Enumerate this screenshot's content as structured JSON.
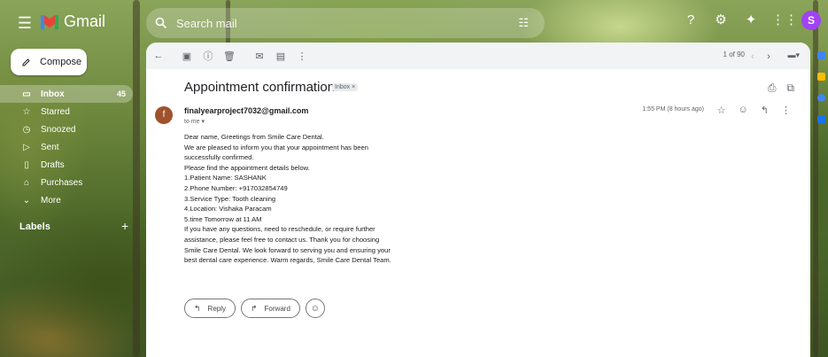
{
  "app": {
    "name": "Gmail"
  },
  "search": {
    "placeholder": "Search mail"
  },
  "compose": {
    "label": "Compose"
  },
  "sidebar": {
    "items": [
      {
        "label": "Inbox",
        "count": "45",
        "icon": "inbox-icon",
        "active": true
      },
      {
        "label": "Starred",
        "count": "",
        "icon": "star-icon"
      },
      {
        "label": "Snoozed",
        "count": "",
        "icon": "clock-icon"
      },
      {
        "label": "Sent",
        "count": "",
        "icon": "send-icon"
      },
      {
        "label": "Drafts",
        "count": "",
        "icon": "draft-icon"
      },
      {
        "label": "Purchases",
        "count": "",
        "icon": "tag-icon"
      },
      {
        "label": "More",
        "count": "",
        "icon": "chevron-down-icon"
      }
    ],
    "labels_header": "Labels"
  },
  "toolbar": {
    "pager": "1 of 90"
  },
  "email": {
    "subject": "Appointment confirmation",
    "label_chip": "Inbox ×",
    "sender": "finalyearproject7032@gmail.com",
    "sender_initial": "f",
    "to": "to me ▾",
    "time": "1:55 PM (8 hours ago)",
    "body": [
      "Dear name, Greetings from Smile Care Dental.",
      "We are pleased to inform you that your appointment has been",
      "successfully confirmed.",
      "Please find the appointment details below.",
      "1.Patient Name: SASHANK",
      "2.Phone Number: +917032854749",
      "3.Service Type: Tooth cleaning",
      "4.Location: Vishaka Paracam",
      "5.time Tomorrow at 11 AM",
      "If you have any questions, need to reschedule, or require further",
      "assistance, please feel free to contact us. Thank you for choosing",
      "Smile Care Dental. We look forward to serving you and ensuring your",
      "best dental care experience. Warm regards,  Smile Care Dental Team."
    ],
    "reply_label": "Reply",
    "forward_label": "Forward"
  },
  "colors": {
    "gmail_red": "#ea4335",
    "gmail_blue": "#4285f4",
    "gmail_yellow": "#fbbc04",
    "gmail_green": "#34a853",
    "avatar_purple": "#a142f4",
    "sender_avatar": "#a0522d"
  }
}
